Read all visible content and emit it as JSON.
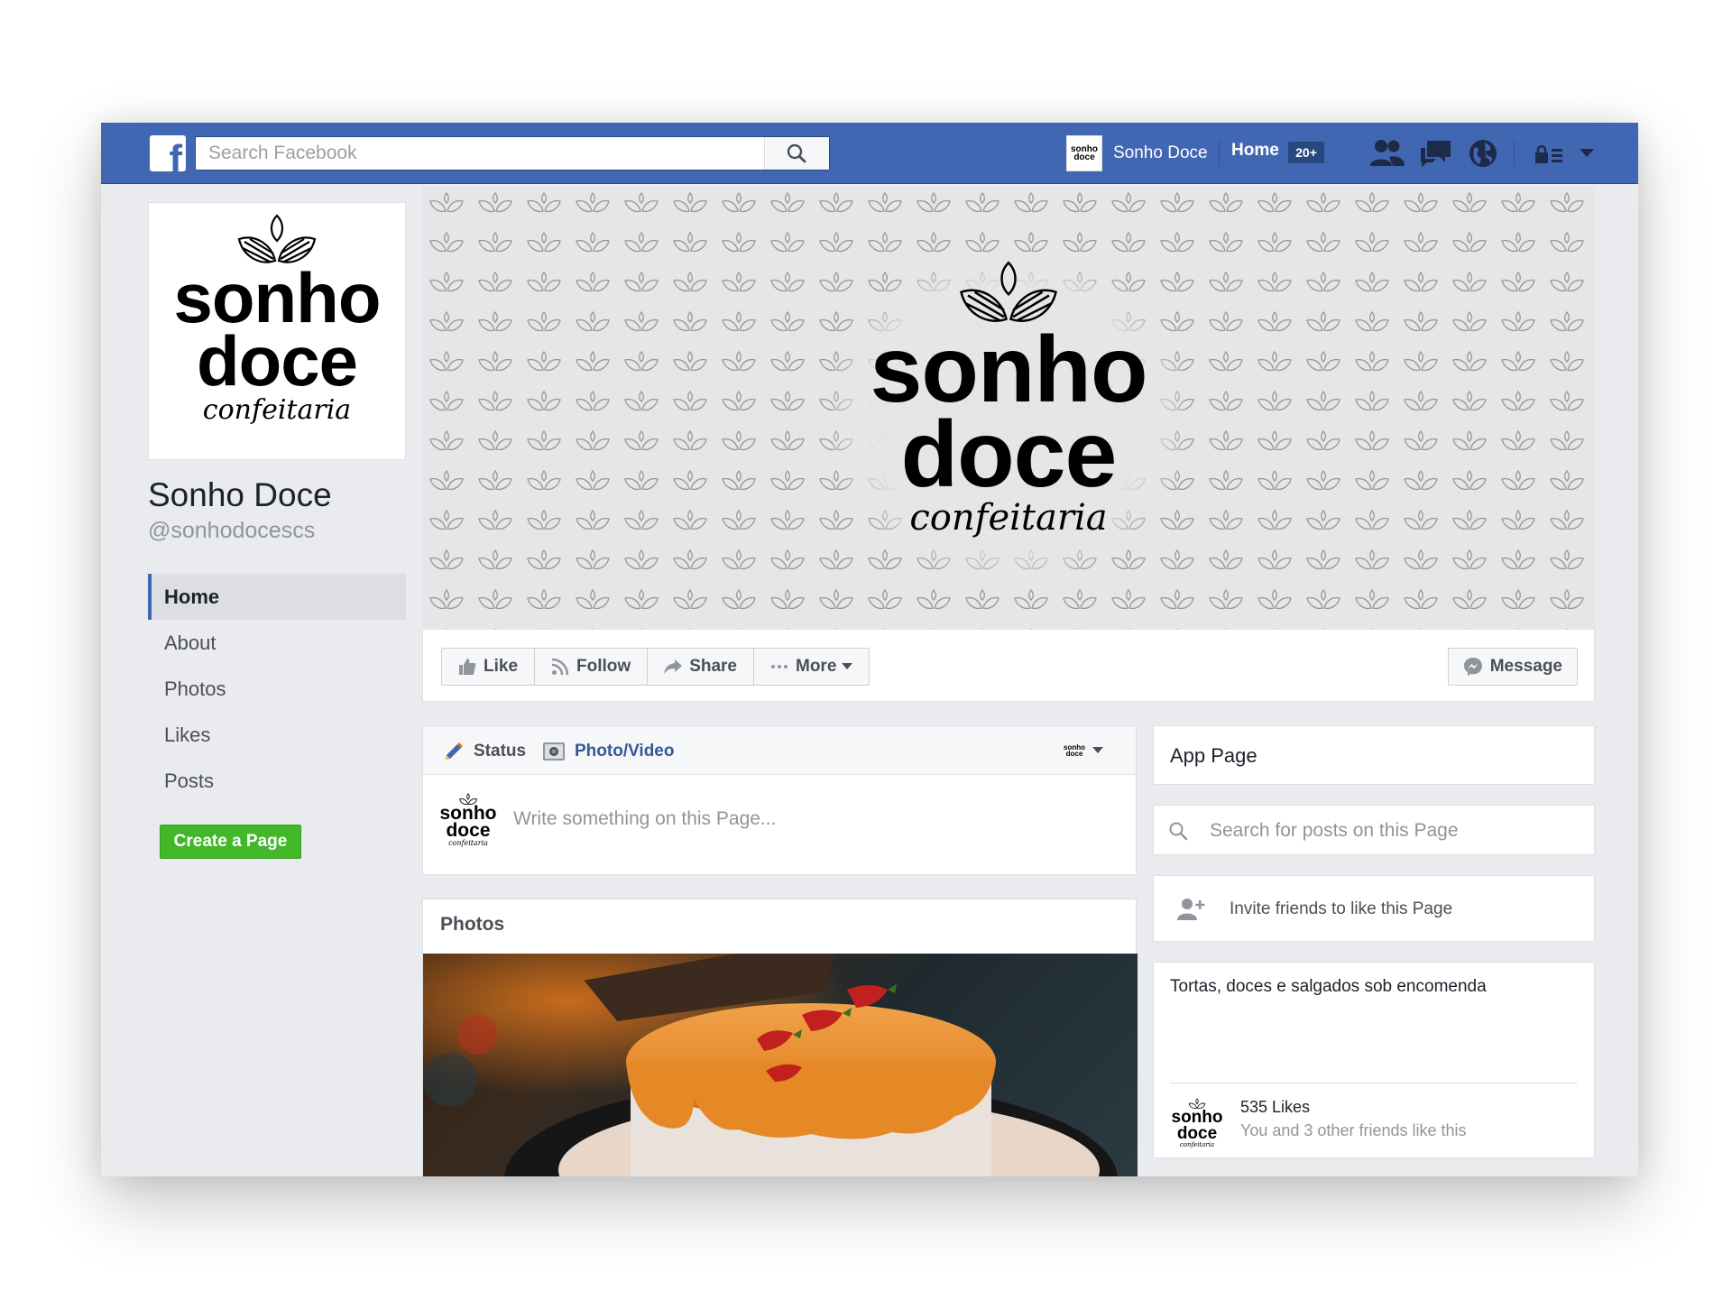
{
  "topbar": {
    "logo_letter": "f",
    "search_placeholder": "Search Facebook",
    "profile_name": "Sonho Doce",
    "home_label": "Home",
    "home_badge": "20+"
  },
  "brand": {
    "word1": "sonho",
    "word2": "doce",
    "script": "confeitaria"
  },
  "page": {
    "name": "Sonho Doce",
    "handle": "@sonhodocescs"
  },
  "left_nav": [
    {
      "label": "Home",
      "active": true
    },
    {
      "label": "About"
    },
    {
      "label": "Photos"
    },
    {
      "label": "Likes"
    },
    {
      "label": "Posts"
    }
  ],
  "create_page_label": "Create a Page",
  "actions": {
    "like": "Like",
    "follow": "Follow",
    "share": "Share",
    "more": "More",
    "message": "Message"
  },
  "composer": {
    "status_tab": "Status",
    "photo_tab": "Photo/Video",
    "placeholder": "Write something on this Page..."
  },
  "photos": {
    "title": "Photos"
  },
  "right": {
    "app_page": "App Page",
    "search_placeholder": "Search for posts on this Page",
    "invite": "Invite friends to like this Page",
    "about": "Tortas, doces e salgados sob encomenda",
    "likes_count": "535 Likes",
    "likes_friends": "You and 3 other friends like this"
  },
  "colors": {
    "fb_blue": "#4267b2",
    "link_blue": "#365899",
    "green": "#42b72a",
    "background": "#e9ebee"
  }
}
